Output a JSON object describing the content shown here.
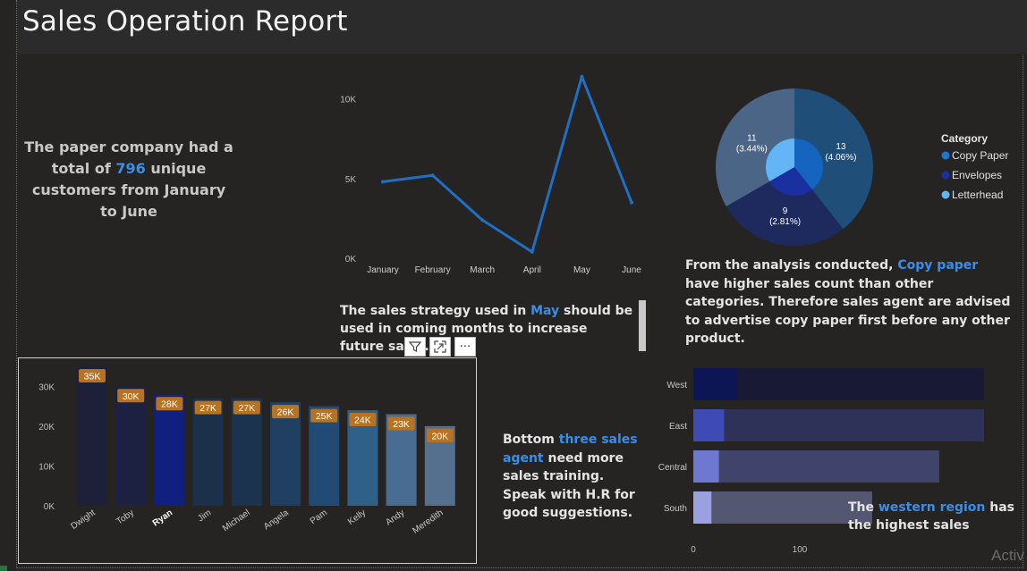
{
  "report": {
    "title": "Sales Operation Report"
  },
  "notes": {
    "customers": {
      "p1": "The paper company had a total of ",
      "count": "796",
      "p2": " unique customers from January to June"
    },
    "strategy": {
      "p1": "The sales strategy used in ",
      "month": "May",
      "p2": " should be used in coming months to increase future sales."
    },
    "category": {
      "p1": "From the analysis conducted, ",
      "highlight": "Copy paper",
      "p2": " have higher sales count than other categories. Therefore sales agent are advised to advertise copy paper first before any other product."
    },
    "agents": {
      "p1": "Bottom ",
      "highlight": "three sales agent",
      "p2": " need more sales training. Speak with H.R for good suggestions."
    },
    "region": {
      "p1": "The ",
      "highlight": "western region",
      "p2": " has the highest sales"
    }
  },
  "toolbar": {
    "filter_icon": "filter-icon",
    "focus_icon": "focus-mode-icon",
    "more_icon": "more-options-icon",
    "more_label": "···"
  },
  "watermark": "Activ",
  "colors": {
    "accent": "#3a8ee8",
    "line": "#1f6fc4",
    "bar_label": "#b87322",
    "background": "#252423"
  },
  "chart_data": [
    {
      "type": "line",
      "categories": [
        "January",
        "February",
        "March",
        "April",
        "May",
        "June"
      ],
      "values": [
        4800,
        5200,
        2400,
        400,
        11400,
        3500
      ],
      "yticks": [
        "0K",
        "5K",
        "10K"
      ],
      "ytick_values": [
        0,
        5000,
        10000
      ],
      "ylim": [
        0,
        12000
      ],
      "grid": false
    },
    {
      "type": "pie",
      "variant": "nested-donut",
      "legend_title": "Category",
      "legend_position": "right",
      "slices": [
        {
          "name": "Copy Paper",
          "value": 13,
          "label": "13",
          "pct": "(4.06%)",
          "color": "#1f4e79",
          "inner_color": "#1565c0"
        },
        {
          "name": "Envelopes",
          "value": 9,
          "label": "9",
          "pct": "(2.81%)",
          "color": "#1e2a5e",
          "inner_color": "#1a2fa0"
        },
        {
          "name": "Letterhead",
          "value": 11,
          "label": "11",
          "pct": "(3.44%)",
          "color": "#4a6585",
          "inner_color": "#64b5f6"
        }
      ],
      "legend_colors": [
        "#1976d2",
        "#1a2fa0",
        "#64b5f6"
      ]
    },
    {
      "type": "bar",
      "categories": [
        "Dwight",
        "Toby",
        "Ryan",
        "Jim",
        "Michael",
        "Angela",
        "Pam",
        "Kelly",
        "Andy",
        "Meredith"
      ],
      "values": [
        35,
        30,
        28,
        27,
        27,
        26,
        25,
        24,
        23,
        20
      ],
      "labels": [
        "35K",
        "30K",
        "28K",
        "27K",
        "27K",
        "26K",
        "25K",
        "24K",
        "23K",
        "20K"
      ],
      "colors": [
        "#1c2139",
        "#1c2142",
        "#11207e",
        "#1b3049",
        "#1c3350",
        "#1f4062",
        "#214a75",
        "#2f6088",
        "#486c92",
        "#55708c"
      ],
      "highlight": "Ryan",
      "yticks": [
        "0K",
        "10K",
        "20K",
        "30K"
      ],
      "ytick_values": [
        0,
        10,
        20,
        30
      ],
      "ylim": [
        0,
        35
      ]
    },
    {
      "type": "bar",
      "orientation": "horizontal",
      "categories": [
        "West",
        "East",
        "Central",
        "South"
      ],
      "values": [
        320,
        275,
        231,
        168
      ],
      "inner_values": [
        41,
        29,
        24,
        17
      ],
      "colors": [
        "#181a35",
        "#2e3258",
        "#40446a",
        "#535772"
      ],
      "inner_colors": [
        "#0c1655",
        "#3e4bb5",
        "#6f78d0",
        "#9ba1e0"
      ],
      "xticks": [
        "0",
        "100"
      ],
      "xtick_values": [
        0,
        100
      ]
    }
  ]
}
